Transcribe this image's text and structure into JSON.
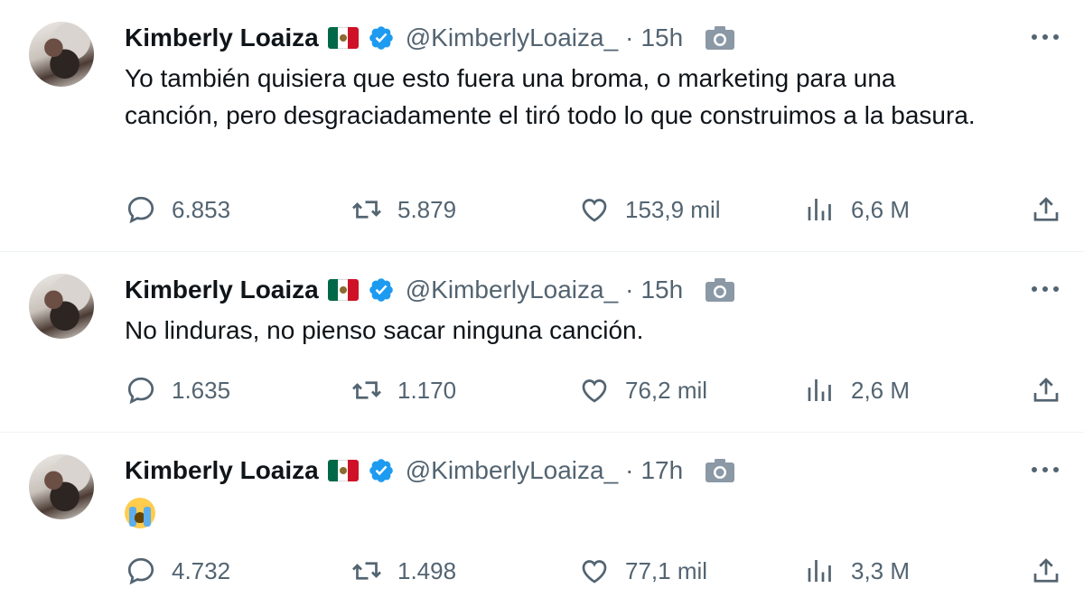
{
  "tweets": [
    {
      "name": "Kimberly Loaiza",
      "flag": "mexico-flag",
      "handle": "@KimberlyLoaiza_",
      "separator": "·",
      "time": "15h",
      "text": "Yo también quisiera que esto fuera una broma, o marketing para una canción, pero desgraciadamente el tiró todo lo que construimos a la basura.",
      "replies": "6.853",
      "retweets": "5.879",
      "likes": "153,9 mil",
      "views": "6,6 M"
    },
    {
      "name": "Kimberly Loaiza",
      "flag": "mexico-flag",
      "handle": "@KimberlyLoaiza_",
      "separator": "·",
      "time": "15h",
      "text": "No linduras, no pienso sacar ninguna canción.",
      "replies": "1.635",
      "retweets": "1.170",
      "likes": "76,2 mil",
      "views": "2,6 M"
    },
    {
      "name": "Kimberly Loaiza",
      "flag": "mexico-flag",
      "handle": "@KimberlyLoaiza_",
      "separator": "·",
      "time": "17h",
      "text": "",
      "emoji": "loudly-crying-face",
      "replies": "4.732",
      "retweets": "1.498",
      "likes": "77,1 mil",
      "views": "3,3 M"
    }
  ],
  "colors": {
    "text": "#0f1419",
    "secondary": "#536471",
    "verified": "#1d9bf0",
    "divider": "#eff3f4"
  },
  "icons": [
    "reply-icon",
    "retweet-icon",
    "like-icon",
    "views-icon",
    "share-icon",
    "camera-icon",
    "verified-badge-icon",
    "more-options-icon"
  ]
}
